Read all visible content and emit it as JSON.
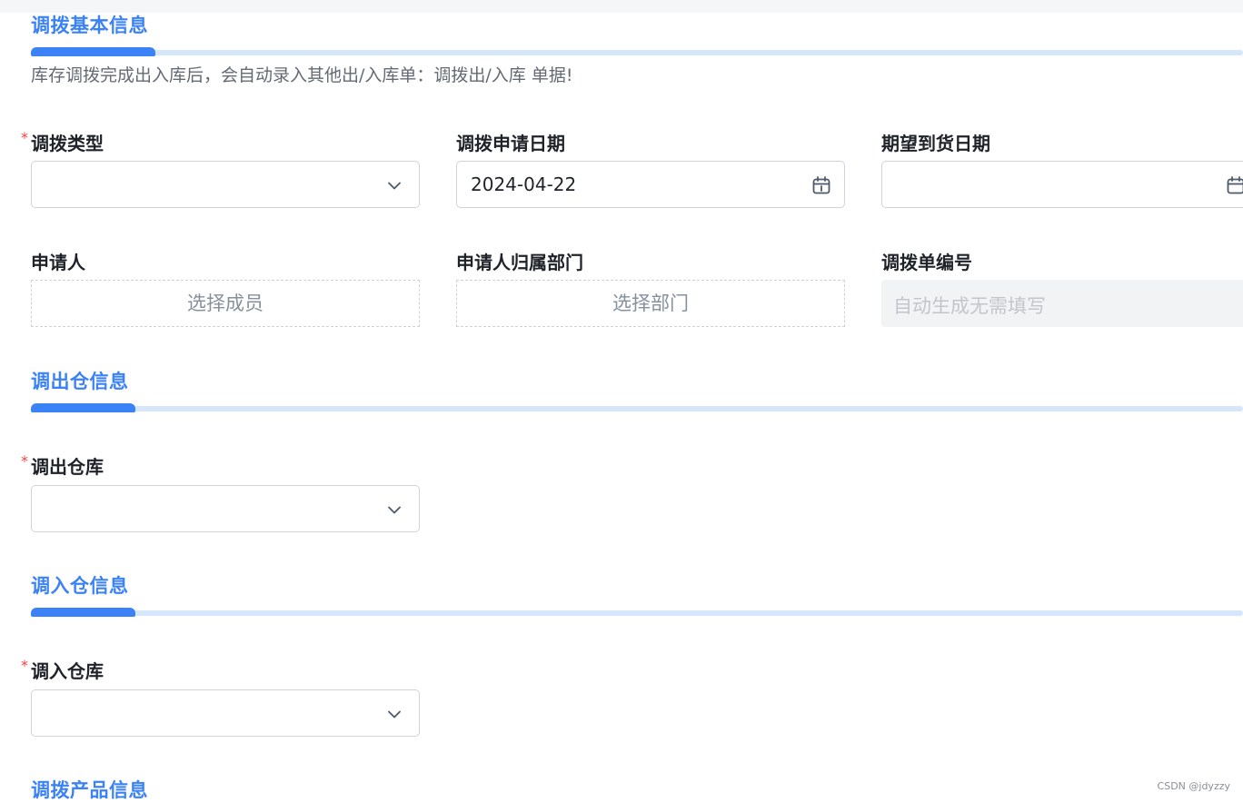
{
  "sections": {
    "basic": {
      "title": "调拨基本信息",
      "note": "库存调拨完成出入库后，会自动录入其他出/入库单：调拨出/入库 单据!"
    },
    "out_warehouse": {
      "title": "调出仓信息"
    },
    "in_warehouse": {
      "title": "调入仓信息"
    },
    "products": {
      "title": "调拨产品信息"
    }
  },
  "fields": {
    "transfer_type": {
      "label": "调拨类型",
      "required_mark": "*",
      "value": ""
    },
    "apply_date": {
      "label": "调拨申请日期",
      "value": "2024-04-22"
    },
    "expected_date": {
      "label": "期望到货日期",
      "value": ""
    },
    "applicant": {
      "label": "申请人",
      "placeholder": "选择成员"
    },
    "applicant_dept": {
      "label": "申请人归属部门",
      "placeholder": "选择部门"
    },
    "order_no": {
      "label": "调拨单编号",
      "placeholder": "自动生成无需填写"
    },
    "out_warehouse": {
      "label": "调出仓库",
      "required_mark": "*",
      "value": ""
    },
    "in_warehouse": {
      "label": "调入仓库",
      "required_mark": "*",
      "value": ""
    }
  },
  "watermark": "CSDN @jdyzzy",
  "colors": {
    "accent": "#3b82f6",
    "accent_light": "#d6e6fb",
    "required": "#f53f3f",
    "placeholder": "#86909c"
  },
  "icons": {
    "select_arrow": "chevron-down-icon",
    "date": "calendar-icon"
  }
}
